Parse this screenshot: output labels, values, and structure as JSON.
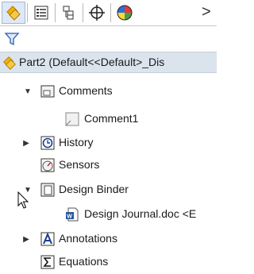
{
  "toolbar": {
    "tabs": [
      {
        "icon": "feature-manager-icon",
        "active": true
      },
      {
        "icon": "property-manager-icon",
        "active": false
      },
      {
        "icon": "configuration-manager-icon",
        "active": false
      },
      {
        "icon": "dimxpert-manager-icon",
        "active": false
      },
      {
        "icon": "display-manager-icon",
        "active": false
      }
    ],
    "more_label": ">"
  },
  "filter": {
    "icon": "filter-icon"
  },
  "tree": {
    "part_label": "Part2  (Default<<Default>_Dis",
    "items": [
      {
        "label": "Comments",
        "icon": "comments-folder-icon",
        "expander": "▼"
      },
      {
        "label": "Comment1",
        "icon": "comment-note-icon",
        "expander": ""
      },
      {
        "label": "History",
        "icon": "history-icon",
        "expander": "▶"
      },
      {
        "label": "Sensors",
        "icon": "sensors-icon",
        "expander": ""
      },
      {
        "label": "Design Binder",
        "icon": "design-binder-icon",
        "expander": "▼"
      },
      {
        "label": "Design Journal.doc <E",
        "icon": "word-document-icon",
        "expander": ""
      },
      {
        "label": "Annotations",
        "icon": "annotations-icon",
        "expander": "▶"
      },
      {
        "label": "Equations",
        "icon": "equations-icon",
        "expander": ""
      }
    ]
  },
  "colors": {
    "selection_bg": "#dbe3ed",
    "accent": "#2a5db0"
  }
}
